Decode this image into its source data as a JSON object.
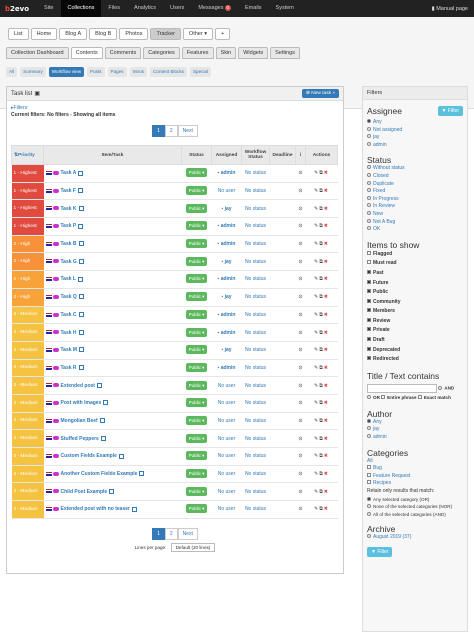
{
  "topbar": {
    "brand_b": "b",
    "brand_rest": "2evo",
    "items": [
      "Site",
      "Collections",
      "Files",
      "Analytics",
      "Users",
      "Messages",
      "Emails",
      "System"
    ],
    "messages_badge": "0",
    "manual": "Manual page"
  },
  "tabs1": [
    "List",
    "Home",
    "Blog A",
    "Blog B",
    "Photos",
    "Tracker",
    "Other ▾",
    "+"
  ],
  "tabs2": [
    "Collection Dashboard",
    "Contents",
    "Comments",
    "Categories",
    "Features",
    "Skin",
    "Widgets",
    "Settings"
  ],
  "tabs3": [
    "All",
    "Summary",
    "Workflow view",
    "Posts",
    "Pages",
    "Intros",
    "Content Blocks",
    "Special"
  ],
  "panel": {
    "title": "Task list",
    "new_task": "New task »",
    "filters_link": "Filters:",
    "current_filters": "Current filters: No filters - Showing all items",
    "pages": [
      "1",
      "2",
      "Next"
    ],
    "lines_per_page_label": "Lines per page:",
    "lines_per_page_value": "Default (20 lines)"
  },
  "table": {
    "headers": [
      "Priority",
      "Item/Task",
      "Status",
      "Assigned",
      "Workflow Status",
      "Deadline",
      "i",
      "Actions"
    ],
    "rows": [
      {
        "prio": "1 - Highest",
        "task": "Task A",
        "status": "Public ▾",
        "assigned": "admin",
        "wf": "No status",
        "color": "#e04a3f"
      },
      {
        "prio": "1 - Highest",
        "task": "Task F",
        "status": "Public ▾",
        "assigned": "No user",
        "wf": "No status",
        "color": "#e04a3f"
      },
      {
        "prio": "1 - Highest",
        "task": "Task K",
        "status": "Public ▾",
        "assigned": "jay",
        "wf": "No status",
        "color": "#e04a3f"
      },
      {
        "prio": "1 - Highest",
        "task": "Task P",
        "status": "Public ▾",
        "assigned": "admin",
        "wf": "No status",
        "color": "#e04a3f"
      },
      {
        "prio": "2 - High",
        "task": "Task B",
        "status": "Public ▾",
        "assigned": "admin",
        "wf": "No status",
        "color": "#f7923a"
      },
      {
        "prio": "2 - High",
        "task": "Task G",
        "status": "Public ▾",
        "assigned": "jay",
        "wf": "No status",
        "color": "#f7923a"
      },
      {
        "prio": "2 - High",
        "task": "Task L",
        "status": "Public ▾",
        "assigned": "admin",
        "wf": "No status",
        "color": "#f7a33a"
      },
      {
        "prio": "2 - High",
        "task": "Task Q",
        "status": "Public ▾",
        "assigned": "jay",
        "wf": "No status",
        "color": "#f7a33a"
      },
      {
        "prio": "3 - Medium",
        "task": "Task C",
        "status": "Public ▾",
        "assigned": "admin",
        "wf": "No status",
        "color": "#f5c242"
      },
      {
        "prio": "3 - Medium",
        "task": "Task H",
        "status": "Public ▾",
        "assigned": "admin",
        "wf": "No status",
        "color": "#f5c242"
      },
      {
        "prio": "3 - Medium",
        "task": "Task M",
        "status": "Public ▾",
        "assigned": "jay",
        "wf": "No status",
        "color": "#f5c242"
      },
      {
        "prio": "3 - Medium",
        "task": "Task R",
        "status": "Public ▾",
        "assigned": "admin",
        "wf": "No status",
        "color": "#f5c242"
      },
      {
        "prio": "3 - Medium",
        "task": "Extended post",
        "status": "Public ▾",
        "assigned": "No user",
        "wf": "No status",
        "color": "#f5c242"
      },
      {
        "prio": "3 - Medium",
        "task": "Post with Images",
        "status": "Public ▾",
        "assigned": "No user",
        "wf": "No status",
        "color": "#f5c242"
      },
      {
        "prio": "3 - Medium",
        "task": "Mongolian Beef",
        "status": "Public ▾",
        "assigned": "No user",
        "wf": "No status",
        "color": "#f5c242"
      },
      {
        "prio": "3 - Medium",
        "task": "Stuffed Peppers",
        "status": "Public ▾",
        "assigned": "No user",
        "wf": "No status",
        "color": "#f5c242"
      },
      {
        "prio": "3 - Medium",
        "task": "Custom Fields Example",
        "status": "Public ▾",
        "assigned": "No user",
        "wf": "No status",
        "color": "#f5c242"
      },
      {
        "prio": "3 - Medium",
        "task": "Another Custom Fields Example",
        "status": "Public ▾",
        "assigned": "No user",
        "wf": "No status",
        "color": "#f5c242"
      },
      {
        "prio": "3 - Medium",
        "task": "Child Post Example",
        "status": "Public ▾",
        "assigned": "No user",
        "wf": "No status",
        "color": "#f5c242"
      },
      {
        "prio": "3 - Medium",
        "task": "Extended post with no teaser",
        "status": "Public ▾",
        "assigned": "No user",
        "wf": "No status",
        "color": "#f5c242"
      }
    ]
  },
  "sidebar": {
    "header": "Filters",
    "assignee_title": "Assignee",
    "filter_btn": "Filter",
    "assignee": [
      "Any",
      "Not assigned",
      "jay",
      "admin"
    ],
    "status_title": "Status",
    "status": [
      "Without status",
      "Closed",
      "Duplicate",
      "Fixed",
      "In Progress",
      "In Review",
      "New",
      "Not A Bug",
      "OK"
    ],
    "items_title": "Items to show",
    "items": [
      {
        "label": "Flagged",
        "on": false
      },
      {
        "label": "Must read",
        "on": false
      },
      {
        "label": "Past",
        "on": true
      },
      {
        "label": "Future",
        "on": true
      },
      {
        "label": "Public",
        "on": true
      },
      {
        "label": "Community",
        "on": true
      },
      {
        "label": "Members",
        "on": true
      },
      {
        "label": "Review",
        "on": true
      },
      {
        "label": "Private",
        "on": true
      },
      {
        "label": "Draft",
        "on": true
      },
      {
        "label": "Deprecated",
        "on": true
      },
      {
        "label": "Redirected",
        "on": true
      }
    ],
    "title_text_title": "Title / Text contains",
    "and_label": "AND",
    "or_label": "OR",
    "entire_phrase": "Entire phrase",
    "exact_match": "Exact match",
    "author_title": "Author",
    "author": [
      "Any",
      "jay",
      "admin"
    ],
    "categories_title": "Categories",
    "categories": [
      "All",
      "Bug",
      "Feature Request",
      "Recipes"
    ],
    "retain_label": "Retain only results that match:",
    "retain": [
      "Any selected category (OR)",
      "None of the selected categories (NOR)",
      "All of the selected categories (AND)"
    ],
    "archive_title": "Archive",
    "archive": [
      "August 2019 (37)"
    ],
    "filter_bottom": "Filter"
  }
}
